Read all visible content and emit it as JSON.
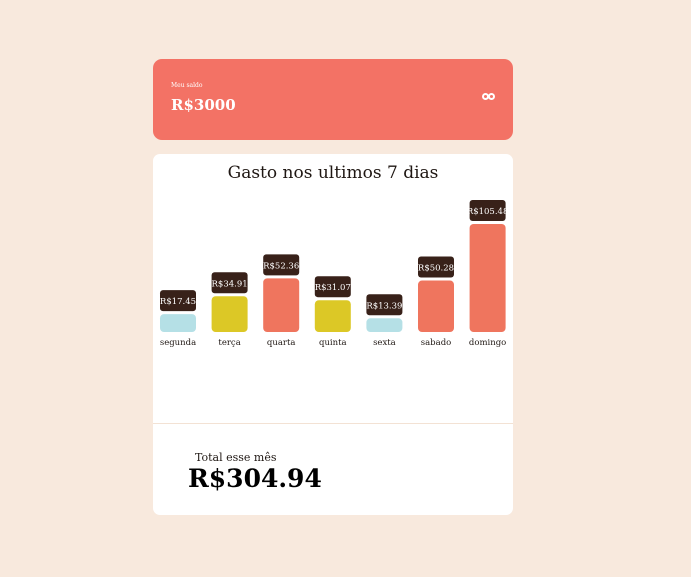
{
  "balance": {
    "label": "Meu saldo",
    "value": "R$3000",
    "logo_icon": "two-circles-logo-icon"
  },
  "chart_card": {
    "title": "Gasto nos ultimos 7 dias",
    "total_label": "Total esse mês",
    "total_value": "R$304.94"
  },
  "colors": {
    "background": "#f8e9dd",
    "accent": "#f37265",
    "bar_light": "#b5e0e6",
    "bar_yellow": "#dcc826",
    "bar_red": "#ef755e",
    "tooltip": "#382119"
  },
  "chart_data": {
    "type": "bar",
    "title": "Gasto nos ultimos 7 dias",
    "categories": [
      "segunda",
      "terça",
      "quarta",
      "quinta",
      "sexta",
      "sabado",
      "domingo"
    ],
    "values": [
      17.45,
      34.91,
      52.36,
      31.07,
      13.39,
      50.28,
      105.48
    ],
    "value_labels": [
      "R$17.45",
      "R$34.91",
      "R$52.36",
      "R$31.07",
      "R$13.39",
      "R$50.28",
      "R$105.48"
    ],
    "bar_colors": [
      "#b5e0e6",
      "#dcc826",
      "#ef755e",
      "#dcc826",
      "#b5e0e6",
      "#ef755e",
      "#ef755e"
    ],
    "xlabel": "",
    "ylabel": "",
    "grid": false,
    "legend": "none"
  }
}
